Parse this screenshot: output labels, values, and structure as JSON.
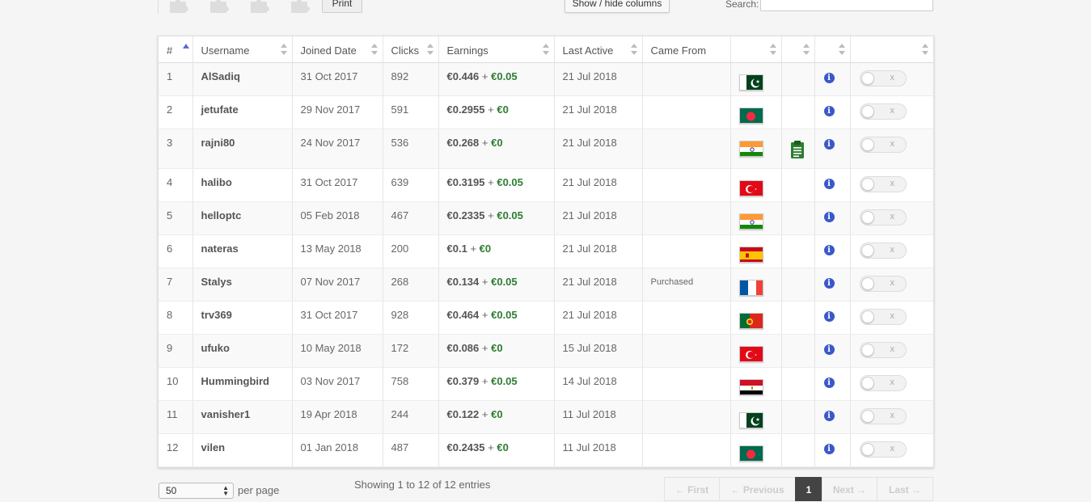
{
  "toolbar": {
    "print_label": "Print",
    "columns_label": "Show / hide columns",
    "search_label": "Search:",
    "search_value": ""
  },
  "table": {
    "headers": [
      "#",
      "Username",
      "Joined Date",
      "Clicks",
      "Earnings",
      "Last Active",
      "Came From",
      "",
      "",
      "",
      ""
    ],
    "rows": [
      {
        "num": "1",
        "username": "AlSadiq",
        "joined": "31 Oct 2017",
        "clicks": "892",
        "earn_main": "€0.446",
        "earn_bonus": "€0.05",
        "last_active": "21 Jul 2018",
        "came_from": "",
        "flag": "pakistan"
      },
      {
        "num": "2",
        "username": "jetufate",
        "joined": "29 Nov 2017",
        "clicks": "591",
        "earn_main": "€0.2955",
        "earn_bonus": "€0",
        "last_active": "21 Jul 2018",
        "came_from": "",
        "flag": "bangladesh"
      },
      {
        "num": "3",
        "username": "rajni80",
        "joined": "24 Nov 2017",
        "clicks": "536",
        "earn_main": "€0.268",
        "earn_bonus": "€0",
        "last_active": "21 Jul 2018",
        "came_from": "",
        "flag": "india",
        "note": true
      },
      {
        "num": "4",
        "username": "halibo",
        "joined": "31 Oct 2017",
        "clicks": "639",
        "earn_main": "€0.3195",
        "earn_bonus": "€0.05",
        "last_active": "21 Jul 2018",
        "came_from": "",
        "flag": "turkey"
      },
      {
        "num": "5",
        "username": "helloptc",
        "joined": "05 Feb 2018",
        "clicks": "467",
        "earn_main": "€0.2335",
        "earn_bonus": "€0.05",
        "last_active": "21 Jul 2018",
        "came_from": "",
        "flag": "india"
      },
      {
        "num": "6",
        "username": "nateras",
        "joined": "13 May 2018",
        "clicks": "200",
        "earn_main": "€0.1",
        "earn_bonus": "€0",
        "last_active": "21 Jul 2018",
        "came_from": "",
        "flag": "spain"
      },
      {
        "num": "7",
        "username": "Stalys",
        "joined": "07 Nov 2017",
        "clicks": "268",
        "earn_main": "€0.134",
        "earn_bonus": "€0.05",
        "last_active": "21 Jul 2018",
        "came_from": "Purchased",
        "flag": "france"
      },
      {
        "num": "8",
        "username": "trv369",
        "joined": "31 Oct 2017",
        "clicks": "928",
        "earn_main": "€0.464",
        "earn_bonus": "€0.05",
        "last_active": "21 Jul 2018",
        "came_from": "",
        "flag": "portugal"
      },
      {
        "num": "9",
        "username": "ufuko",
        "joined": "10 May 2018",
        "clicks": "172",
        "earn_main": "€0.086",
        "earn_bonus": "€0",
        "last_active": "15 Jul 2018",
        "came_from": "",
        "flag": "turkey"
      },
      {
        "num": "10",
        "username": "Hummingbird",
        "joined": "03 Nov 2017",
        "clicks": "758",
        "earn_main": "€0.379",
        "earn_bonus": "€0.05",
        "last_active": "14 Jul 2018",
        "came_from": "",
        "flag": "egypt"
      },
      {
        "num": "11",
        "username": "vanisher1",
        "joined": "19 Apr 2018",
        "clicks": "244",
        "earn_main": "€0.122",
        "earn_bonus": "€0",
        "last_active": "11 Jul 2018",
        "came_from": "",
        "flag": "pakistan"
      },
      {
        "num": "12",
        "username": "vilen",
        "joined": "01 Jan 2018",
        "clicks": "487",
        "earn_main": "€0.2435",
        "earn_bonus": "€0",
        "last_active": "11 Jul 2018",
        "came_from": "",
        "flag": "bangladesh"
      }
    ],
    "plus": "+",
    "toggle_x": "x",
    "info_glyph": "i"
  },
  "footer": {
    "per_page_value": "50",
    "per_page_label": "per page",
    "showing": "Showing 1 to 12 of 12 entries",
    "pager": {
      "first": "← First",
      "previous": "← Previous",
      "current": "1",
      "next": "Next →",
      "last": "Last →"
    }
  },
  "colors": {
    "bonus_green": "#2e7d32",
    "info_blue": "#3a58c9",
    "sort_active": "#5a6dcf",
    "note_green": "#2e7d32"
  },
  "icons": {
    "rating": "puzzle-icon",
    "info": "info-icon",
    "note": "clipboard-icon",
    "sort": "sort-icon"
  }
}
